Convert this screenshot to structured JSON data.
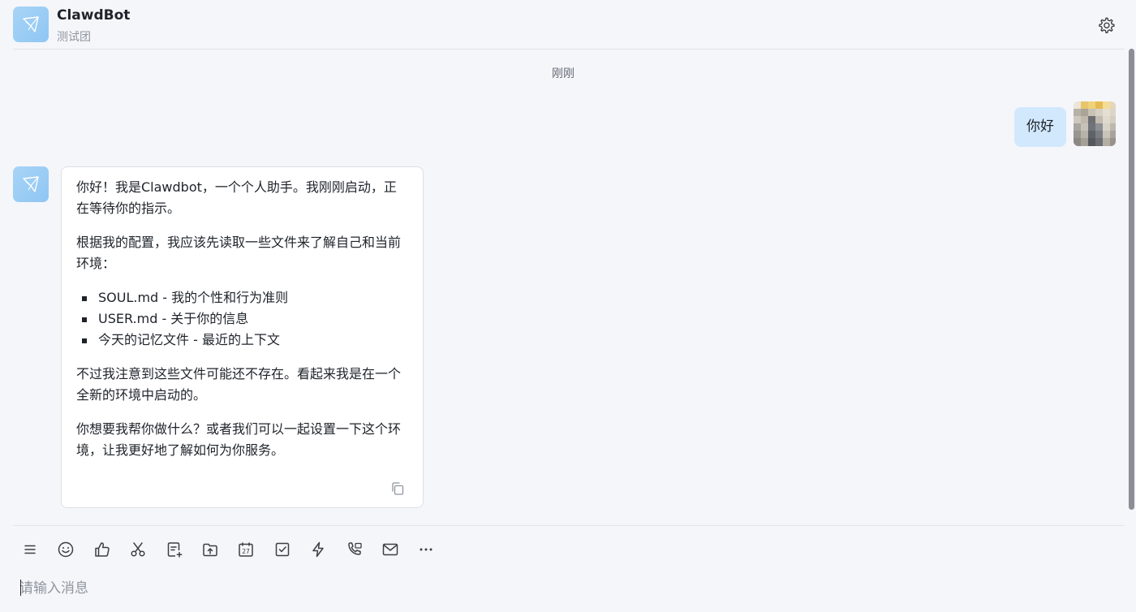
{
  "header": {
    "title": "ClawdBot",
    "subtitle": "测试团",
    "settings_icon": "gear-icon"
  },
  "conversation": {
    "time_divider": "刚刚",
    "user_message": {
      "text": "你好",
      "avatar": "user-avatar"
    },
    "bot_message": {
      "avatar": "bot-avatar",
      "paragraphs": [
        "你好！我是Clawdbot，一个个人助手。我刚刚启动，正在等待你的指示。",
        "根据我的配置，我应该先读取一些文件来了解自己和当前环境："
      ],
      "list": [
        "SOUL.md - 我的个性和行为准则",
        "USER.md - 关于你的信息",
        "今天的记忆文件 - 最近的上下文"
      ],
      "paragraphs_after": [
        "不过我注意到这些文件可能还不存在。看起来我是在一个全新的环境中启动的。",
        "你想要我帮你做什么？或者我们可以一起设置一下这个环境，让我更好地了解如何为你服务。"
      ],
      "copy_icon": "copy-icon"
    }
  },
  "composer": {
    "toolbar": [
      {
        "icon": "menu-icon"
      },
      {
        "icon": "emoji-icon"
      },
      {
        "icon": "thumbs-up-icon"
      },
      {
        "icon": "scissors-icon"
      },
      {
        "icon": "new-doc-icon"
      },
      {
        "icon": "upload-folder-icon"
      },
      {
        "icon": "calendar-icon",
        "label": "27"
      },
      {
        "icon": "task-icon"
      },
      {
        "icon": "lightning-icon"
      },
      {
        "icon": "phone-icon"
      },
      {
        "icon": "mail-icon"
      },
      {
        "icon": "more-icon"
      }
    ],
    "input_placeholder": "请输入消息"
  },
  "colors": {
    "background": "#f5f6fa",
    "user_bubble": "#d1e8fd",
    "bot_avatar": "#a8d4f7"
  }
}
